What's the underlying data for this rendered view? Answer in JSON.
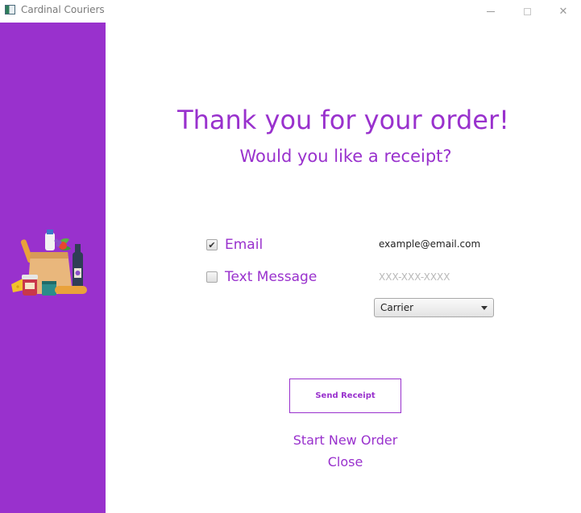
{
  "window": {
    "title": "Cardinal Couriers",
    "close_glyph": "✕"
  },
  "sidebar": {
    "background": "#9931cd",
    "icon": "grocery-bag-icon"
  },
  "main": {
    "heading": "Thank you for your order!",
    "subheading": "Would you like a receipt?",
    "accent": "#9931cd"
  },
  "receipt_options": {
    "email": {
      "label": "Email",
      "checked": true,
      "check_glyph": "✔",
      "value": "example@email.com"
    },
    "text_message": {
      "label": "Text Message",
      "checked": false,
      "placeholder": "XXX-XXX-XXXX"
    },
    "carrier": {
      "selected": "Carrier"
    }
  },
  "actions": {
    "send_receipt": "Send Receipt",
    "start_new_order": "Start New Order",
    "close": "Close"
  }
}
